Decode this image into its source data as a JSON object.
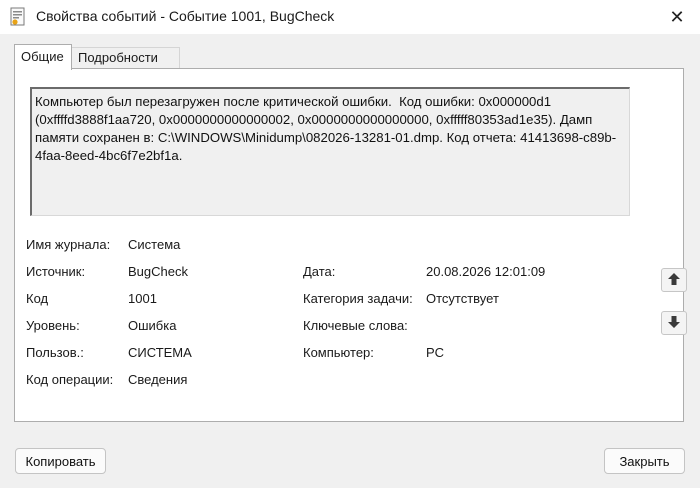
{
  "window": {
    "title": "Свойства событий - Событие 1001, BugCheck",
    "close_glyph": "✕"
  },
  "tabs": [
    {
      "label": "Общие",
      "active": true
    },
    {
      "label": "Подробности",
      "active": false
    }
  ],
  "description": "Компьютер был перезагружен после критической ошибки.  Код ошибки: 0x000000d1 (0xffffd3888f1aa720, 0x0000000000000002, 0x0000000000000000, 0xfffff80353ad1e35). Дамп памяти сохранен в: C:\\WINDOWS\\Minidump\\082026-13281-01.dmp. Код отчета: 41413698-c89b-4faa-8eed-4bc6f7e2bf1a.",
  "fields": {
    "log_name": {
      "label": "Имя журнала:",
      "value": "Система"
    },
    "source": {
      "label": "Источник:",
      "value": "BugCheck"
    },
    "date": {
      "label": "Дата:",
      "value": "20.08.2026 12:01:09"
    },
    "event_id": {
      "label": "Код",
      "value": "1001"
    },
    "task_category": {
      "label": "Категория задачи:",
      "value": "Отсутствует"
    },
    "level": {
      "label": "Уровень:",
      "value": "Ошибка"
    },
    "keywords": {
      "label": "Ключевые слова:",
      "value": ""
    },
    "user": {
      "label": "Пользов.:",
      "value": "СИСТЕМА"
    },
    "computer": {
      "label": "Компьютер:",
      "value": "PC"
    },
    "opcode": {
      "label": "Код операции:",
      "value": "Сведения"
    }
  },
  "buttons": {
    "copy": "Копировать",
    "close": "Закрыть"
  },
  "icons": {
    "app": "event-properties-icon",
    "up": "arrow-up-icon",
    "down": "arrow-down-icon"
  },
  "colors": {
    "panel_bg": "#ffffff",
    "window_bg": "#f0f0f0",
    "description_bg": "#f0f0f0"
  }
}
